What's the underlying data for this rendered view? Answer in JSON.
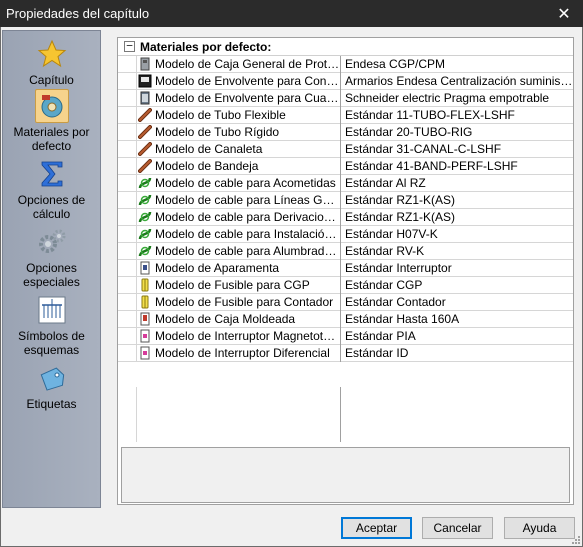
{
  "window": {
    "title": "Propiedades del capítulo"
  },
  "sidebar": {
    "items": [
      {
        "label_line1": "Capítulo",
        "label_line2": "",
        "icon": "star-icon"
      },
      {
        "label_line1": "Materiales por",
        "label_line2": "defecto",
        "icon": "materials-icon"
      },
      {
        "label_line1": "Opciones de",
        "label_line2": "cálculo",
        "icon": "sigma-icon"
      },
      {
        "label_line1": "Opciones",
        "label_line2": "especiales",
        "icon": "gears-icon"
      },
      {
        "label_line1": "Símbolos de",
        "label_line2": "esquemas",
        "icon": "schema-symbol-icon"
      },
      {
        "label_line1": "Etiquetas",
        "label_line2": "",
        "icon": "tag-icon"
      }
    ]
  },
  "group": {
    "toggle": "−",
    "title": "Materiales por defecto:"
  },
  "rows": [
    {
      "prop": "Modelo de Caja General de Protección",
      "value": "Endesa CGP/CPM",
      "icon": "cgp-box-icon"
    },
    {
      "prop": "Modelo de Envolvente para Contadores",
      "value": "Armarios Endesa Centralización suministros eléctricos",
      "icon": "meter-enclosure-icon"
    },
    {
      "prop": "Modelo de Envolvente para Cuadros",
      "value": "Schneider electric Pragma empotrable",
      "icon": "panel-enclosure-icon"
    },
    {
      "prop": "Modelo de Tubo Flexible",
      "value": "Estándar 11-TUBO-FLEX-LSHF",
      "icon": "tube-icon"
    },
    {
      "prop": "Modelo de Tubo Rígido",
      "value": "Estándar 20-TUBO-RIG",
      "icon": "tube-icon"
    },
    {
      "prop": "Modelo de Canaleta",
      "value": "Estándar 31-CANAL-C-LSHF",
      "icon": "tube-icon"
    },
    {
      "prop": "Modelo de Bandeja",
      "value": "Estándar 41-BAND-PERF-LSHF",
      "icon": "tube-icon"
    },
    {
      "prop": "Modelo de cable para Acometidas",
      "value": "Estándar Al RZ",
      "icon": "cable-icon"
    },
    {
      "prop": "Modelo de cable para Líneas Generales",
      "value": "Estándar RZ1-K(AS)",
      "icon": "cable-icon"
    },
    {
      "prop": "Modelo de cable para Derivaciones Individuales",
      "value": "Estándar RZ1-K(AS)",
      "icon": "cable-icon"
    },
    {
      "prop": "Modelo de cable para Instalación Interior",
      "value": "Estándar H07V-K",
      "icon": "cable-icon"
    },
    {
      "prop": "Modelo de cable para Alumbrado Exterior",
      "value": "Estándar RV-K",
      "icon": "cable-icon"
    },
    {
      "prop": "Modelo de Aparamenta",
      "value": "Estándar Interruptor",
      "icon": "switchgear-icon"
    },
    {
      "prop": "Modelo de Fusible para CGP",
      "value": "Estándar CGP",
      "icon": "fuse-icon"
    },
    {
      "prop": "Modelo de Fusible para Contador",
      "value": "Estándar Contador",
      "icon": "fuse-icon"
    },
    {
      "prop": "Modelo de Caja Moldeada",
      "value": "Estándar Hasta 160A",
      "icon": "molded-case-icon"
    },
    {
      "prop": "Modelo de Interruptor Magnetotérmico",
      "value": "Estándar PIA",
      "icon": "breaker-icon"
    },
    {
      "prop": "Modelo de Interruptor Diferencial",
      "value": "Estándar ID",
      "icon": "breaker-icon"
    }
  ],
  "buttons": {
    "ok": "Aceptar",
    "cancel": "Cancelar",
    "help": "Ayuda"
  },
  "close_glyph": "✕"
}
